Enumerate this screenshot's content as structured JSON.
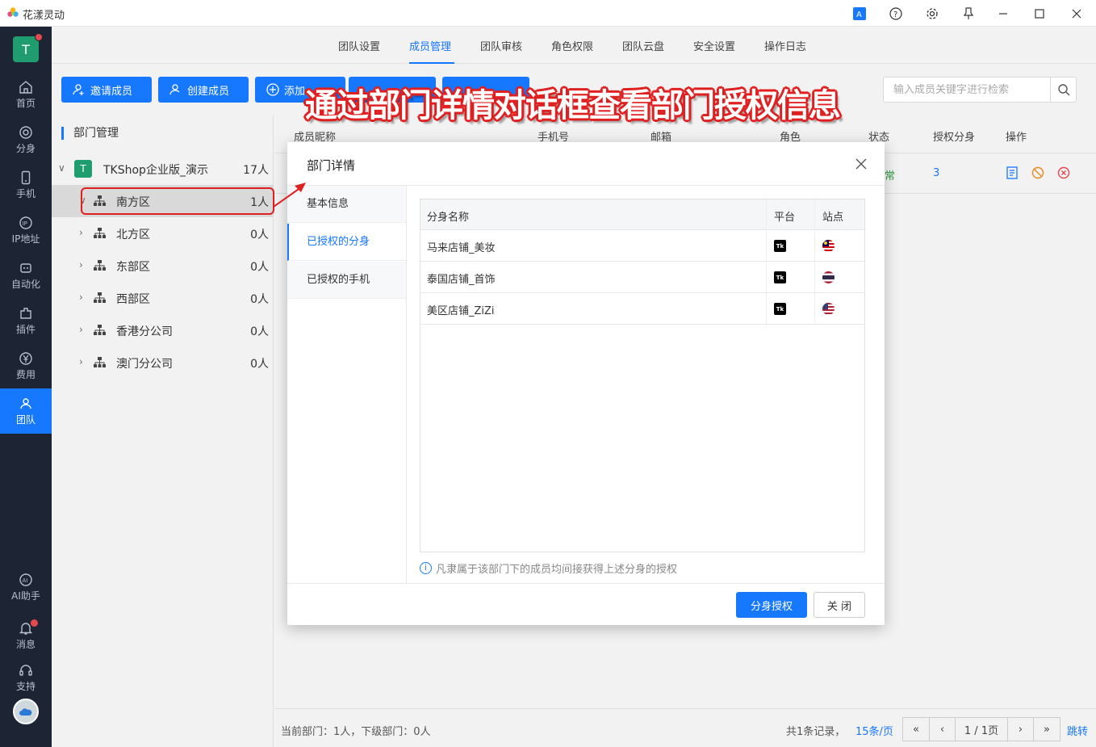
{
  "window": {
    "title": "花漾灵动"
  },
  "left_nav": {
    "avatar_letter": "T",
    "items": [
      {
        "label": "首页",
        "icon": "home-icon"
      },
      {
        "label": "分身",
        "icon": "browser-icon"
      },
      {
        "label": "手机",
        "icon": "phone-icon"
      },
      {
        "label": "IP地址",
        "icon": "ip-icon"
      },
      {
        "label": "自动化",
        "icon": "robot-icon"
      },
      {
        "label": "插件",
        "icon": "plugin-icon"
      },
      {
        "label": "费用",
        "icon": "yen-icon"
      },
      {
        "label": "团队",
        "icon": "team-icon"
      },
      {
        "label": "AI助手",
        "icon": "ai-icon"
      },
      {
        "label": "消息",
        "icon": "bell-icon"
      },
      {
        "label": "支持",
        "icon": "headset-icon"
      }
    ],
    "active": "团队"
  },
  "top_tabs": [
    "团队设置",
    "成员管理",
    "团队审核",
    "角色权限",
    "团队云盘",
    "安全设置",
    "操作日志"
  ],
  "active_tab": "成员管理",
  "actions": {
    "invite": "邀请成员",
    "create": "创建成员",
    "add": "添加"
  },
  "search": {
    "placeholder": "输入成员关键字进行检索"
  },
  "dept_panel": {
    "heading": "部门管理",
    "root": {
      "badge": "T",
      "name": "TKShop企业版_演示",
      "count": "17人"
    },
    "depts": [
      {
        "name": "南方区",
        "count": "1人",
        "selected": true
      },
      {
        "name": "北方区",
        "count": "0人"
      },
      {
        "name": "东部区",
        "count": "0人"
      },
      {
        "name": "西部区",
        "count": "0人"
      },
      {
        "name": "香港分公司",
        "count": "0人"
      },
      {
        "name": "澳门分公司",
        "count": "0人"
      }
    ]
  },
  "member_table": {
    "columns": [
      "成员昵称",
      "手机号",
      "邮箱",
      "角色",
      "状态",
      "授权分身",
      "操作"
    ],
    "row": {
      "status_partial": "常",
      "authorized_count": "3"
    }
  },
  "footer": {
    "dept_info": "当前部门：1人，下级部门：0人",
    "total": "共1条记录，",
    "page_size": "15条/页",
    "page": "1 / 1页",
    "jump": "跳转"
  },
  "modal": {
    "title": "部门详情",
    "tabs": [
      "基本信息",
      "已授权的分身",
      "已授权的手机"
    ],
    "active_tab": "已授权的分身",
    "table": {
      "columns": [
        "分身名称",
        "平台",
        "站点"
      ],
      "rows": [
        {
          "name": "马来店铺_美妆",
          "platform": "TikTok",
          "site": "MY"
        },
        {
          "name": "泰国店铺_首饰",
          "platform": "TikTok",
          "site": "TH"
        },
        {
          "name": "美区店铺_ZiZi",
          "platform": "TikTok",
          "site": "US"
        }
      ]
    },
    "note": "凡隶属于该部门下的成员均间接获得上述分身的授权",
    "primary_button": "分身授权",
    "close_button": "关 闭"
  },
  "annotation": "通过部门详情对话框查看部门授权信息",
  "colors": {
    "primary": "#1677ff",
    "nav_bg": "#1d2535",
    "annotation_red": "#e02020",
    "brand_green": "#1f9d6e"
  }
}
